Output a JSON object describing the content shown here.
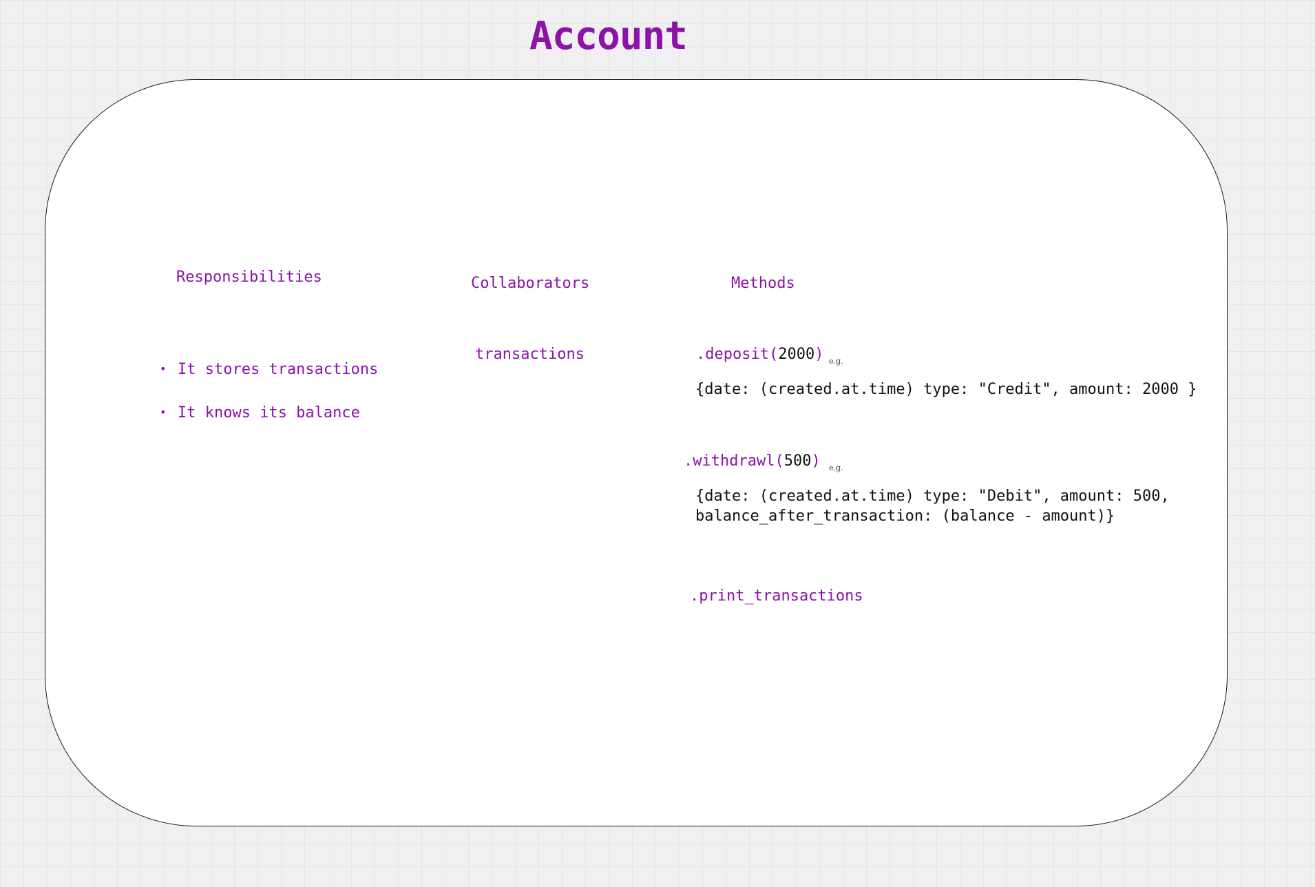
{
  "title": "Account",
  "sections": {
    "responsibilities": {
      "heading": "Responsibilities",
      "items": [
        {
          "bullet": "•",
          "text": "It stores transactions"
        },
        {
          "bullet": "•",
          "text": "It knows its balance"
        }
      ]
    },
    "collaborators": {
      "heading": "Collaborators",
      "items": [
        "transactions"
      ]
    },
    "methods": {
      "heading": "Methods",
      "deposit": {
        "name": ".deposit(",
        "arg": "2000",
        "close": ")",
        "eg": "e.g.",
        "example": "{date: (created.at.time) type: \"Credit\", amount: 2000 }"
      },
      "withdrawl": {
        "name": ".withdrawl(",
        "arg": "500",
        "close": ")",
        "eg": "e.g.",
        "example_line1": "{date: (created.at.time) type: \"Debit\", amount: 500,",
        "example_line2": "balance_after_transaction: (balance - amount)}"
      },
      "print": {
        "name": ".print_transactions"
      }
    }
  },
  "colors": {
    "accent": "#8b13a8",
    "text": "#111111",
    "card_border": "#1a1a1a",
    "background": "#f0f0f0"
  }
}
